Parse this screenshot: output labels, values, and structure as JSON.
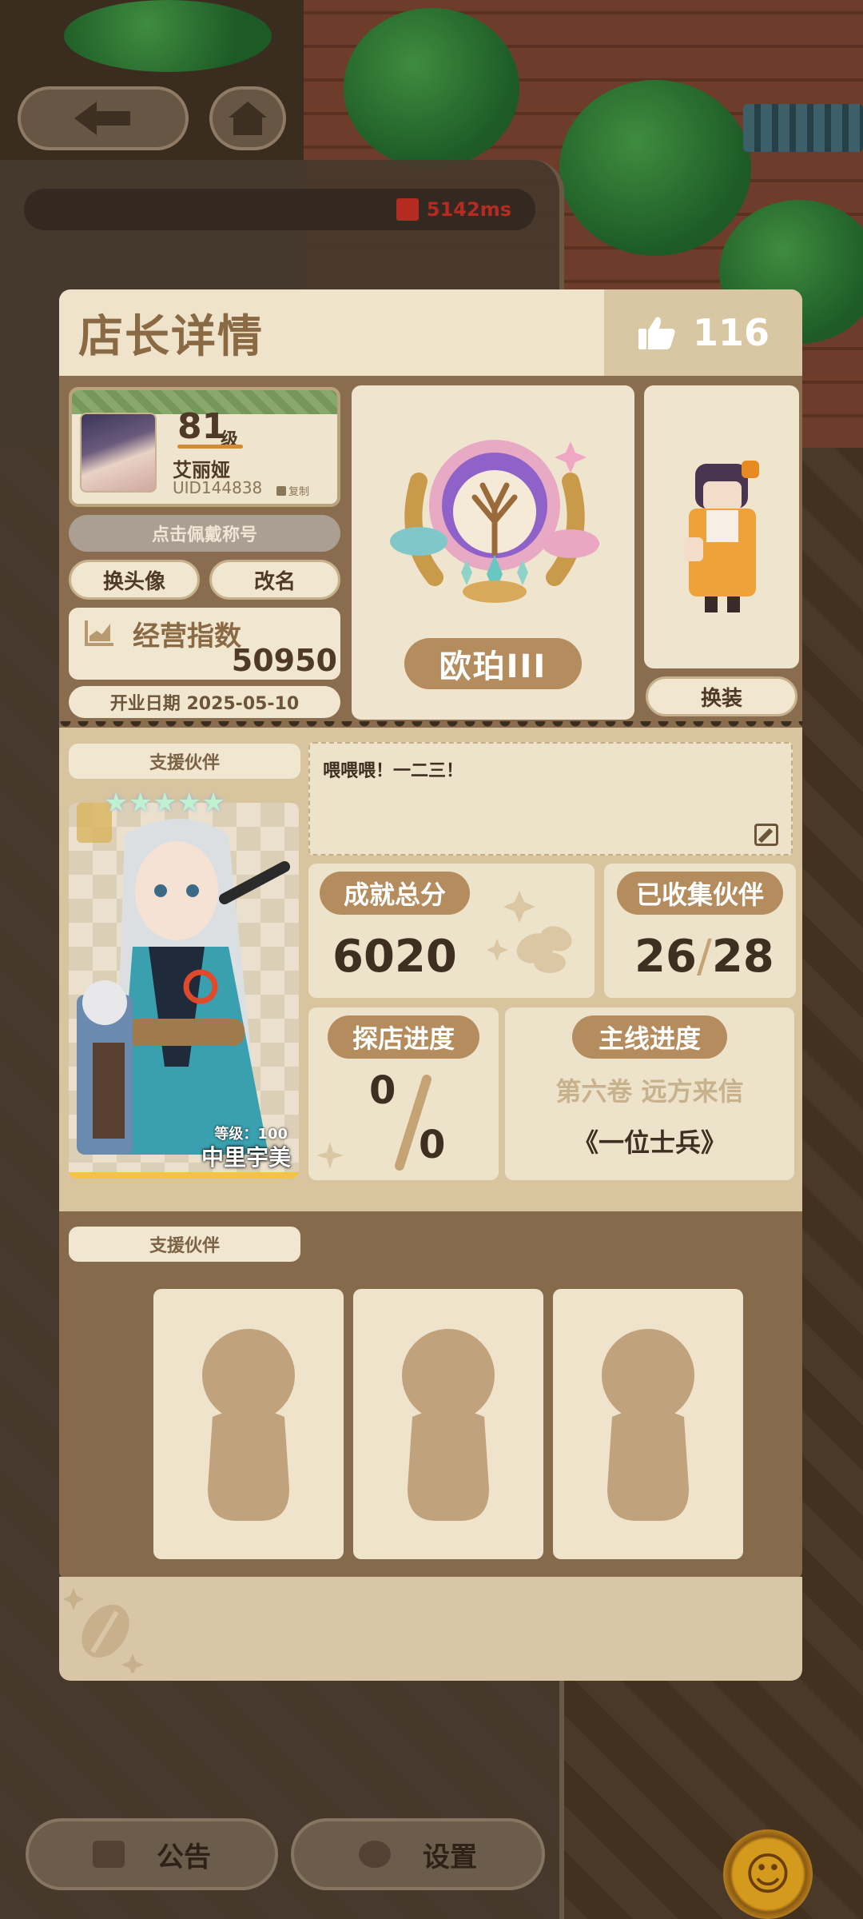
{
  "network": {
    "ping": "5142ms"
  },
  "header": {
    "title": "店长详情",
    "likes": "116"
  },
  "profile": {
    "level": "81",
    "level_unit": "级",
    "nickname": "艾丽娅",
    "uid": "UID144838",
    "copy_label": "复制",
    "title_button": "点击佩戴称号",
    "change_avatar": "换头像",
    "rename": "改名",
    "business_index_label": "经营指数",
    "business_index_value": "50950",
    "open_date": "开业日期 2025-05-10"
  },
  "badge": {
    "rank": "欧珀III"
  },
  "outfit": {
    "change_outfit": "换装"
  },
  "support_partner": {
    "label": "支援伙伴",
    "name": "中里宇美",
    "level": "等级：100",
    "stars": "★★★★★"
  },
  "message": {
    "text": "喂喂喂！一二三！"
  },
  "stats": {
    "achievement_label": "成就总分",
    "achievement_value": "6020",
    "collected_label": "已收集伙伴",
    "collected_have": "26",
    "collected_sep": "/",
    "collected_total": "28",
    "explore_label": "探店进度",
    "explore_have": "0",
    "explore_total": "0",
    "story_label": "主线进度",
    "story_chapter": "第六卷 远方来信",
    "story_episode": "《一位士兵》"
  },
  "team": {
    "label": "支援伙伴"
  },
  "bottom_nav": {
    "notice": "公告",
    "settings": "设置"
  },
  "colors": {
    "accent": "#b48c5e",
    "card_bg": "#efe4cd",
    "ping_red": "#b52b22",
    "title_brown": "#8a6a44"
  }
}
